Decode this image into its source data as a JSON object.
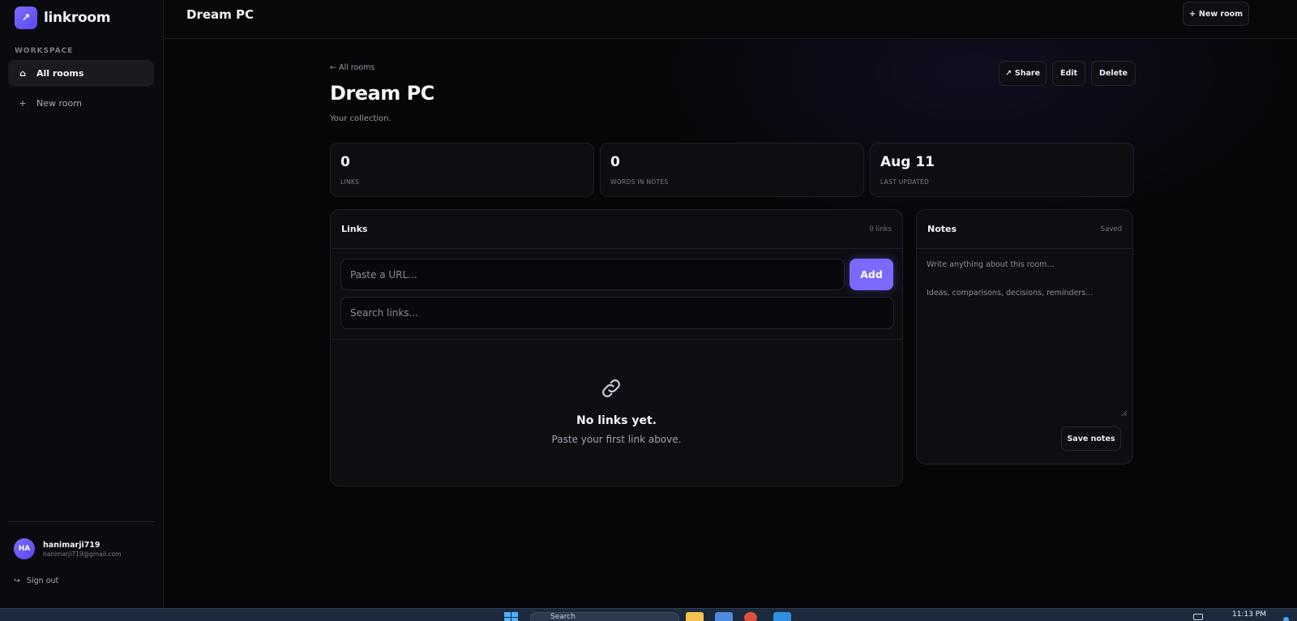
{
  "app": {
    "brand_name": "linkroom",
    "brand_icon": "arrow-up-right-icon",
    "accent_color": "#7c6aff"
  },
  "sidebar": {
    "section_label": "WORKSPACE",
    "items": [
      {
        "label": "All rooms",
        "icon": "home-icon",
        "active": true
      },
      {
        "label": "New room",
        "icon": "plus-icon",
        "active": false
      }
    ],
    "user": {
      "initials": "HA",
      "name": "hanimarji719",
      "email": "hanimarji719@gmail.com"
    },
    "sign_out_label": "Sign out"
  },
  "topbar": {
    "title": "Dream PC",
    "new_room_label": "New room"
  },
  "room": {
    "back_label": "All rooms",
    "title": "Dream PC",
    "subtitle": "Your collection.",
    "actions": {
      "share": "Share",
      "edit": "Edit",
      "delete": "Delete"
    }
  },
  "stats": [
    {
      "value": "0",
      "label": "LINKS"
    },
    {
      "value": "0",
      "label": "WORDS IN NOTES"
    },
    {
      "value": "Aug 11",
      "label": "LAST UPDATED"
    }
  ],
  "links": {
    "title": "Links",
    "count_label": "0 links",
    "url_placeholder": "Paste a URL...",
    "add_label": "Add",
    "search_placeholder": "Search links...",
    "empty_title": "No links yet.",
    "empty_subtitle": "Paste your first link above."
  },
  "notes": {
    "title": "Notes",
    "status": "Saved",
    "placeholder_line1": "Write anything about this room...",
    "placeholder_line2": "Ideas, comparisons, decisions, reminders...",
    "save_label": "Save notes"
  },
  "taskbar": {
    "search_text": "Search",
    "clock": "11:13 PM"
  }
}
